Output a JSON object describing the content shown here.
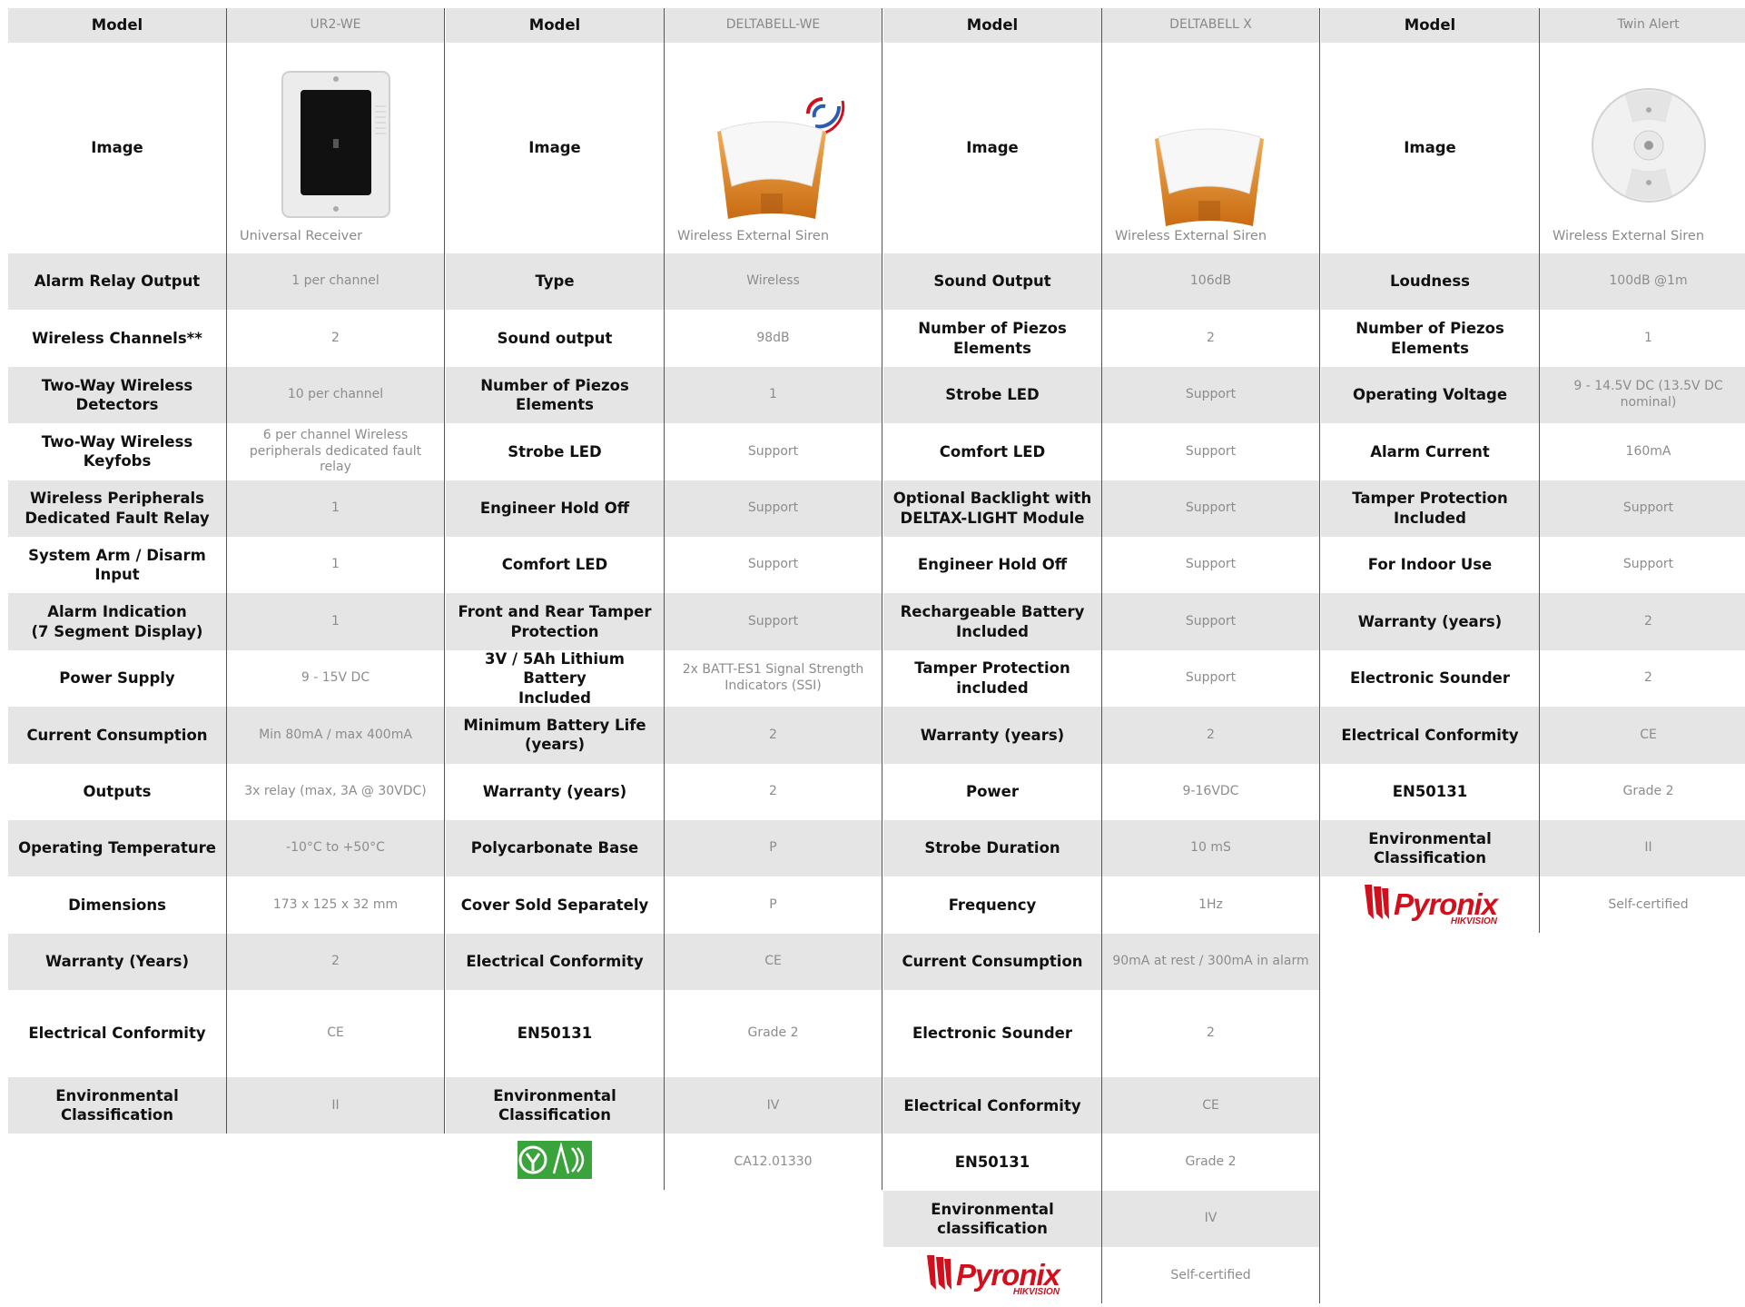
{
  "accent": "#d0101c",
  "tables": [
    {
      "model": "UR2-WE",
      "image_caption": "Universal Receiver",
      "image_icon": "receiver-panel",
      "rows": [
        {
          "label": "Alarm Relay Output",
          "value": "1 per channel"
        },
        {
          "label": "Wireless Channels**",
          "value": "2"
        },
        {
          "label": "Two-Way Wireless\nDetectors",
          "value": "10 per channel"
        },
        {
          "label": "Two-Way Wireless Keyfobs",
          "value": "6 per channel Wireless\nperipherals dedicated fault\nrelay"
        },
        {
          "label": "Wireless Peripherals\nDedicated Fault Relay",
          "value": "1"
        },
        {
          "label": "System Arm / Disarm Input",
          "value": "1"
        },
        {
          "label": "Alarm Indication\n(7 Segment Display)",
          "value": "1"
        },
        {
          "label": "Power Supply",
          "value": "9 - 15V DC"
        },
        {
          "label": "Current Consumption",
          "value": "Min 80mA / max 400mA"
        },
        {
          "label": "Outputs",
          "value": "3x relay (max, 3A @ 30VDC)"
        },
        {
          "label": "Operating Temperature",
          "value": "-10°C to +50°C"
        },
        {
          "label": "Dimensions",
          "value": "173 x 125 x 32 mm"
        },
        {
          "label": "Warranty (Years)",
          "value": "2"
        },
        {
          "label": "Electrical Conformity",
          "value": "CE",
          "tall": true
        },
        {
          "label": "Environmental\nClassification",
          "value": "II"
        }
      ]
    },
    {
      "model": "DELTABELL-WE",
      "image_caption": "Wireless External Siren",
      "image_icon": "deltabell-siren-wireless",
      "rows": [
        {
          "label": "Type",
          "value": "Wireless"
        },
        {
          "label": "Sound output",
          "value": "98dB"
        },
        {
          "label": "Number of Piezos Elements",
          "value": "1"
        },
        {
          "label": "Strobe LED",
          "value": "Support"
        },
        {
          "label": "Engineer Hold Off",
          "value": "Support"
        },
        {
          "label": "Comfort LED",
          "value": "Support"
        },
        {
          "label": "Front and Rear Tamper\nProtection",
          "value": "Support"
        },
        {
          "label": "3V / 5Ah Lithium  Battery\nIncluded",
          "value": "2x BATT-ES1 Signal Strength\nIndicators (SSI)"
        },
        {
          "label": "Minimum Battery Life\n(years)",
          "value": "2"
        },
        {
          "label": "Warranty (years)",
          "value": "2"
        },
        {
          "label": "Polycarbonate Base",
          "value": "P"
        },
        {
          "label": "Cover Sold Separately",
          "value": "P"
        },
        {
          "label": "Electrical Conformity",
          "value": "CE"
        },
        {
          "label": "EN50131",
          "value": "Grade 2",
          "tall": true
        },
        {
          "label": "Environmental\nClassification",
          "value": "IV"
        },
        {
          "label": "",
          "value": "CA12.01330",
          "cert_logo": true
        }
      ]
    },
    {
      "model": "DELTABELL X",
      "image_caption": "Wireless External Siren",
      "image_icon": "deltabell-siren",
      "rows": [
        {
          "label": "Sound Output",
          "value": "106dB"
        },
        {
          "label": "Number of Piezos Elements",
          "value": "2"
        },
        {
          "label": "Strobe LED",
          "value": "Support"
        },
        {
          "label": "Comfort LED",
          "value": "Support"
        },
        {
          "label": "Optional Backlight with\nDELTAX-LIGHT Module",
          "value": "Support"
        },
        {
          "label": "Engineer Hold Off",
          "value": "Support"
        },
        {
          "label": "Rechargeable Battery\nIncluded",
          "value": "Support"
        },
        {
          "label": "Tamper Protection\nincluded",
          "value": "Support"
        },
        {
          "label": "Warranty (years)",
          "value": "2"
        },
        {
          "label": "Power",
          "value": "9-16VDC"
        },
        {
          "label": "Strobe Duration",
          "value": "10 mS"
        },
        {
          "label": "Frequency",
          "value": "1Hz"
        },
        {
          "label": "Current Consumption",
          "value": "90mA at rest / 300mA in alarm"
        },
        {
          "label": "Electronic Sounder",
          "value": "2",
          "tall": true
        },
        {
          "label": "Electrical Conformity",
          "value": "CE"
        },
        {
          "label": "EN50131",
          "value": "Grade 2"
        },
        {
          "label": "Environmental\nclassification",
          "value": "IV"
        },
        {
          "label": "",
          "value": "Self-certified",
          "pyronix_logo": true
        }
      ]
    },
    {
      "model": "Twin Alert",
      "image_caption": "Wireless External Siren",
      "image_icon": "round-sounder",
      "rows": [
        {
          "label": "Loudness",
          "value": "100dB @1m"
        },
        {
          "label": "Number of Piezos Elements",
          "value": "1"
        },
        {
          "label": "Operating Voltage",
          "value": "9 - 14.5V DC (13.5V DC nominal)"
        },
        {
          "label": "Alarm Current",
          "value": "160mA"
        },
        {
          "label": "Tamper Protection\nIncluded",
          "value": "Support"
        },
        {
          "label": "For Indoor Use",
          "value": "Support"
        },
        {
          "label": "Warranty (years)",
          "value": "2"
        },
        {
          "label": "Electronic Sounder",
          "value": "2"
        },
        {
          "label": "Electrical Conformity",
          "value": "CE"
        },
        {
          "label": "EN50131",
          "value": "Grade 2"
        },
        {
          "label": "Environmental\nClassification",
          "value": "II"
        },
        {
          "label": "",
          "value": "Self-certified",
          "pyronix_logo": true
        }
      ]
    }
  ],
  "headers": {
    "model_label": "Model",
    "image_label": "Image"
  },
  "logo": {
    "name": "Pyronix",
    "sub": "HIKVISION"
  }
}
